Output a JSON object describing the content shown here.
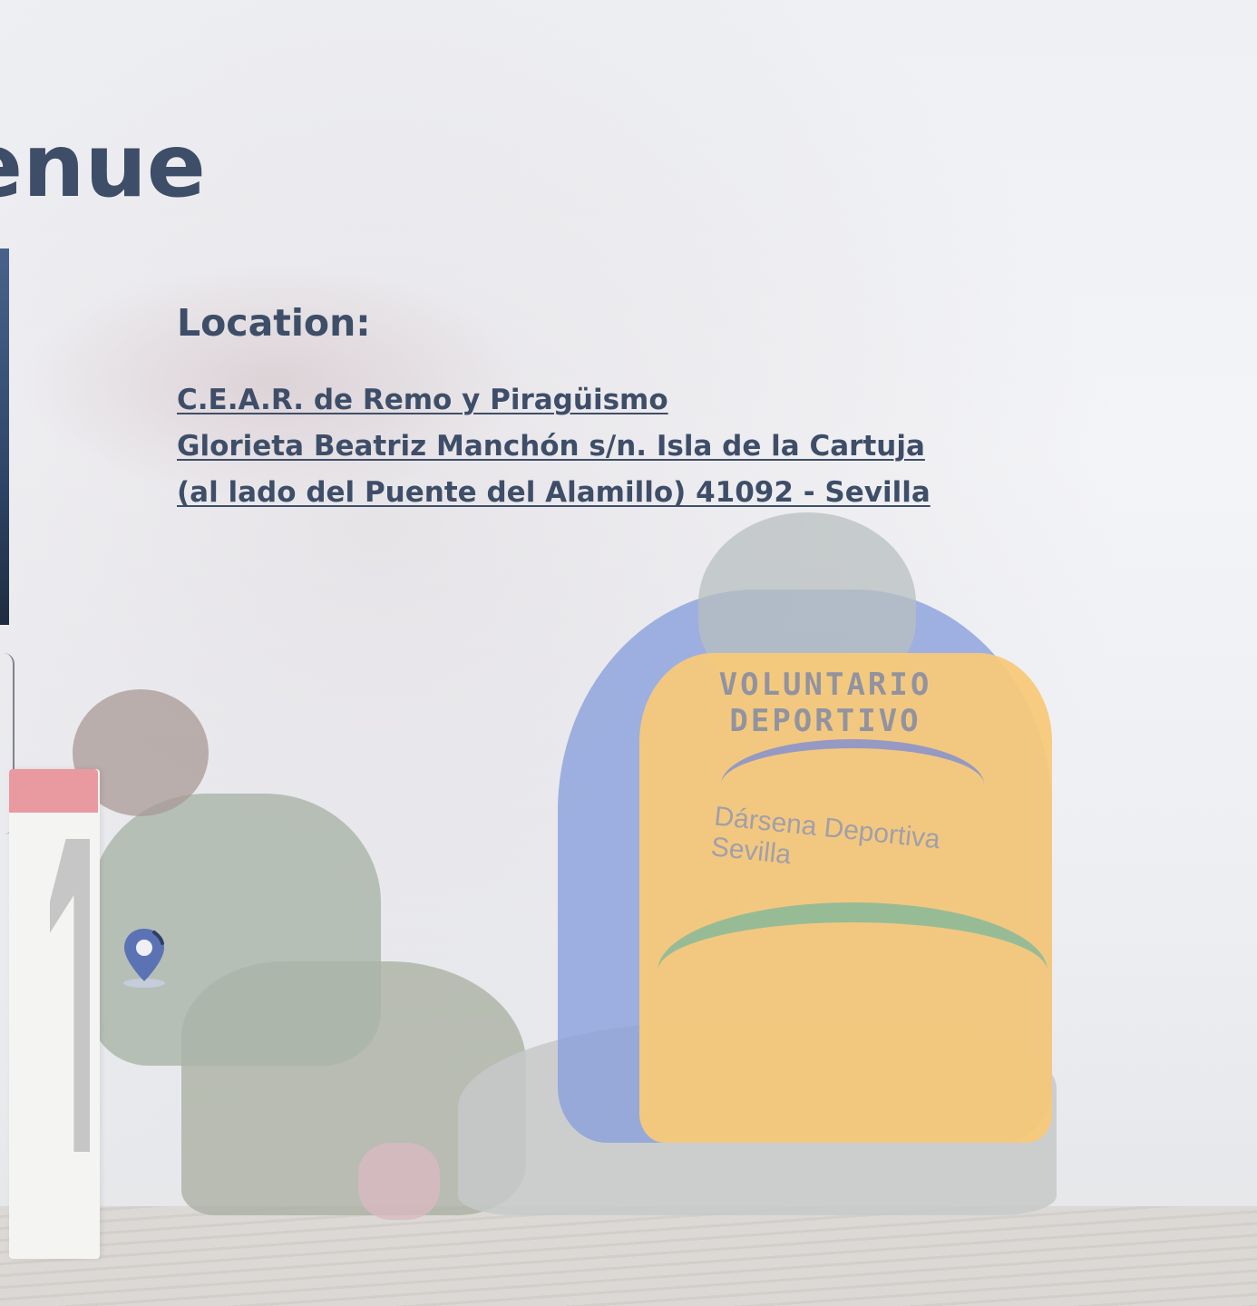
{
  "slide": {
    "title": "enue",
    "location_label": "Location:",
    "address_lines": [
      "C.E.A.R. de Remo y Piragüismo",
      "Glorieta Beatriz Manchón s/n. Isla de la Cartuja",
      "(al lado del Puente del Alamillo) 41092 - Sevilla"
    ],
    "vest_text_lines": [
      "VOLUNTARIO",
      "DEPORTIVO"
    ],
    "vest_logo_text": "Dársena Deportiva Sevilla"
  },
  "icons": {
    "pin": "map-pin-icon"
  },
  "colors": {
    "heading": "#3e4e68",
    "pin": "#5b73b4",
    "vest": "#f7c97a"
  }
}
